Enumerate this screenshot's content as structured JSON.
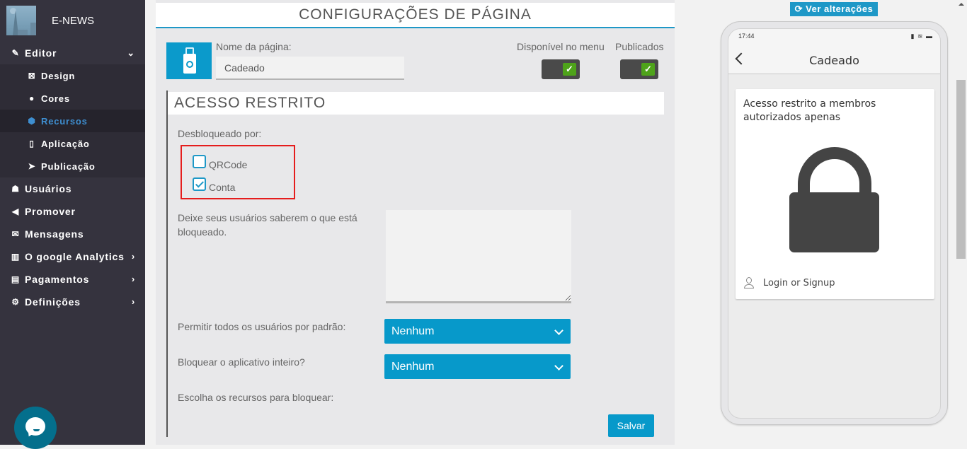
{
  "brand": {
    "name": "E-NEWS"
  },
  "sidebar": {
    "editor": {
      "label": "Editor",
      "icon": "pencil-icon",
      "expanded": true
    },
    "sub_items": [
      {
        "label": "Design",
        "icon": "design-icon",
        "active": false
      },
      {
        "label": "Cores",
        "icon": "palette-icon",
        "active": false
      },
      {
        "label": "Recursos",
        "icon": "cube-icon",
        "active": true
      },
      {
        "label": "Aplicação",
        "icon": "mobile-icon",
        "active": false
      },
      {
        "label": "Publicação",
        "icon": "paper-plane-icon",
        "active": false
      }
    ],
    "items": [
      {
        "label": "Usuários",
        "icon": "users-icon",
        "has_children": false
      },
      {
        "label": "Promover",
        "icon": "megaphone-icon",
        "has_children": false
      },
      {
        "label": "Mensagens",
        "icon": "envelope-icon",
        "has_children": false
      },
      {
        "label": "O google Analytics",
        "icon": "bar-chart-icon",
        "has_children": true
      },
      {
        "label": "Pagamentos",
        "icon": "credit-card-icon",
        "has_children": true
      },
      {
        "label": "Definições",
        "icon": "cogs-icon",
        "has_children": true
      }
    ]
  },
  "main": {
    "title": "CONFIGURAÇÕES DE PÁGINA",
    "page_name_label": "Nome da página:",
    "page_name_value": "Cadeado",
    "menu_toggle_label": "Disponível no menu",
    "menu_toggle_on": true,
    "published_label": "Publicados",
    "published_on": true,
    "section_title": "ACESSO RESTRITO",
    "unlocked_by_label": "Desbloqueado por:",
    "unlock_options": [
      {
        "label": "QRCode",
        "checked": false
      },
      {
        "label": "Conta",
        "checked": true
      }
    ],
    "message_label": "Deixe seus usuários saberem o que está bloqueado.",
    "message_value": "",
    "allow_all_label": "Permitir todos os usuários por padrão:",
    "allow_all_value": "Nenhum",
    "lock_app_label": "Bloquear o aplicativo inteiro?",
    "lock_app_value": "Nenhum",
    "choose_resources_label": "Escolha os recursos para bloquear:",
    "save_label": "Salvar"
  },
  "preview": {
    "button_label": "Ver alterações",
    "status_time": "17:44",
    "status_icons": "signal wifi battery",
    "app_title": "Cadeado",
    "card_text": "Acesso restrito a membros autorizados apenas",
    "login_label": "Login or Signup"
  },
  "colors": {
    "accent": "#0799ca",
    "sidebar_bg": "#35333e",
    "active_nav": "#3e8ed0",
    "toggle_on": "#4ea31a",
    "highlight_box": "#e51d1d"
  }
}
